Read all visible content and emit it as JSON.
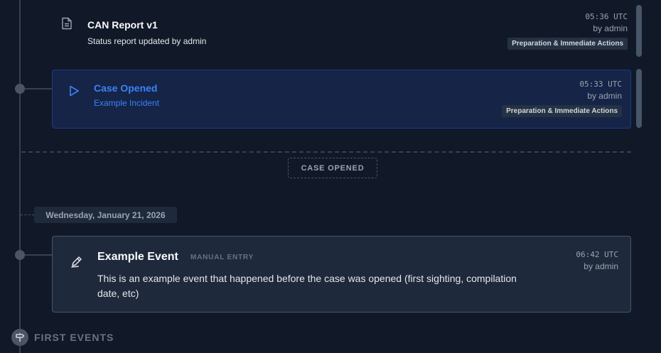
{
  "entries": [
    {
      "title": "CAN Report v1",
      "subtitle": "Status report updated by admin",
      "time": "05:36 UTC",
      "by": "by admin",
      "phase": "Preparation & Immediate Actions",
      "icon": "document-icon"
    },
    {
      "title": "Case Opened",
      "subtitle": "Example Incident",
      "time": "05:33 UTC",
      "by": "by admin",
      "phase": "Preparation & Immediate Actions",
      "icon": "play-icon"
    }
  ],
  "divider": {
    "label": "CASE OPENED"
  },
  "date_group": {
    "label": "Wednesday, January 21, 2026"
  },
  "event": {
    "title": "Example Event",
    "tag": "MANUAL ENTRY",
    "description": "This is an example event that happened before the case was opened (first sighting, compilation date, etc)",
    "time": "06:42 UTC",
    "by": "by admin",
    "icon": "pen-icon"
  },
  "section": {
    "label": "FIRST EVENTS",
    "icon": "signpost-icon"
  },
  "colors": {
    "background": "#111827",
    "highlight_card": "#152447",
    "highlight_text": "#3b82f6",
    "card": "#1e293b"
  }
}
